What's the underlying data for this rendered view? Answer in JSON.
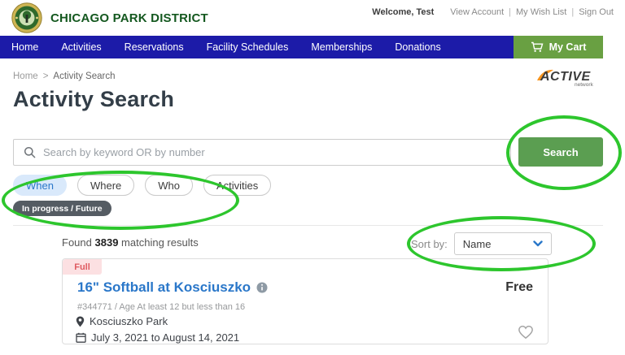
{
  "header": {
    "brand": "CHICAGO PARK DISTRICT",
    "welcome": "Welcome, Test",
    "links": [
      "View Account",
      "My Wish List",
      "Sign Out"
    ],
    "separator": "|"
  },
  "nav": {
    "items": [
      "Home",
      "Activities",
      "Reservations",
      "Facility Schedules",
      "Memberships",
      "Donations"
    ],
    "cart_label": "My Cart"
  },
  "breadcrumb": {
    "items": [
      "Home",
      "Activity Search"
    ],
    "separator": ">"
  },
  "active_logo": {
    "title": "ACTIVE",
    "subtitle": "network"
  },
  "page": {
    "title": "Activity Search"
  },
  "search": {
    "placeholder": "Search by keyword OR by number",
    "value": "",
    "button_label": "Search"
  },
  "filters": {
    "pills": [
      {
        "label": "When",
        "active": true
      },
      {
        "label": "Where",
        "active": false
      },
      {
        "label": "Who",
        "active": false
      },
      {
        "label": "Activities",
        "active": false
      }
    ],
    "applied_tag": "In progress / Future"
  },
  "results": {
    "found_prefix": "Found",
    "count": "3839",
    "found_suffix": "matching results",
    "sort_label": "Sort by:",
    "sort_value": "Name"
  },
  "card": {
    "status_badge": "Full",
    "title": "16\" Softball at Kosciuszko",
    "price": "Free",
    "meta": "#344771 / Age At least 12 but less than 16",
    "location": "Kosciuszko Park",
    "dates": "July 3, 2021 to August 14, 2021"
  },
  "colors": {
    "nav_blue": "#1c1ba8",
    "brand_green": "#14581f",
    "search_button_green": "#5b9e51",
    "cart_green": "#69a042",
    "link_blue": "#2a77c9",
    "pill_active_bg": "#d9e9fb",
    "tag_bg": "#555c63",
    "badge_bg": "#fce0e2",
    "badge_text": "#df5a60",
    "annotation_green": "#2dc62d",
    "active_logo_orange": "#f7941d"
  }
}
